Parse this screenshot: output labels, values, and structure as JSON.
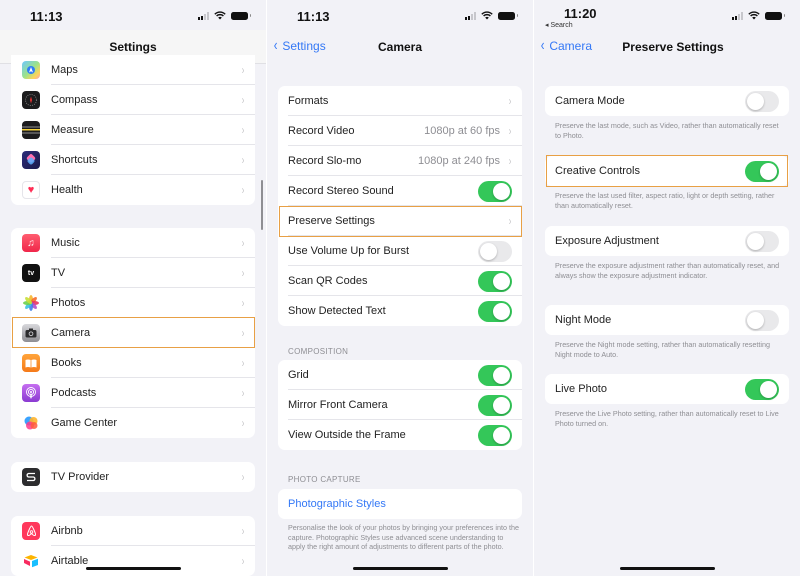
{
  "colors": {
    "accent": "#3478f6",
    "toggle_on": "#34c759",
    "highlight": "#e8a045",
    "background": "#f2f2f7"
  },
  "panel1": {
    "status": {
      "time": "11:13"
    },
    "title": "Settings",
    "groups": [
      {
        "items": [
          {
            "label": "Maps",
            "icon": "maps-icon"
          },
          {
            "label": "Compass",
            "icon": "compass-icon"
          },
          {
            "label": "Measure",
            "icon": "measure-icon"
          },
          {
            "label": "Shortcuts",
            "icon": "shortcuts-icon"
          },
          {
            "label": "Health",
            "icon": "health-icon"
          }
        ]
      },
      {
        "items": [
          {
            "label": "Music",
            "icon": "music-icon"
          },
          {
            "label": "TV",
            "icon": "tv-icon"
          },
          {
            "label": "Photos",
            "icon": "photos-icon"
          },
          {
            "label": "Camera",
            "icon": "camera-icon",
            "highlighted": true
          },
          {
            "label": "Books",
            "icon": "books-icon"
          },
          {
            "label": "Podcasts",
            "icon": "podcasts-icon"
          },
          {
            "label": "Game Center",
            "icon": "game-center-icon"
          }
        ]
      },
      {
        "items": [
          {
            "label": "TV Provider",
            "icon": "tv-provider-icon"
          }
        ]
      },
      {
        "items": [
          {
            "label": "Airbnb",
            "icon": "airbnb-icon"
          },
          {
            "label": "Airtable",
            "icon": "airtable-icon"
          }
        ]
      }
    ]
  },
  "panel2": {
    "status": {
      "time": "11:13"
    },
    "back_label": "Settings",
    "title": "Camera",
    "main_group": [
      {
        "label": "Formats",
        "type": "link"
      },
      {
        "label": "Record Video",
        "type": "link",
        "value": "1080p at 60 fps"
      },
      {
        "label": "Record Slo-mo",
        "type": "link",
        "value": "1080p at 240 fps"
      },
      {
        "label": "Record Stereo Sound",
        "type": "toggle",
        "on": true
      },
      {
        "label": "Preserve Settings",
        "type": "link",
        "highlighted": true
      },
      {
        "label": "Use Volume Up for Burst",
        "type": "toggle",
        "on": false
      },
      {
        "label": "Scan QR Codes",
        "type": "toggle",
        "on": true
      },
      {
        "label": "Show Detected Text",
        "type": "toggle",
        "on": true
      }
    ],
    "composition_header": "COMPOSITION",
    "composition_group": [
      {
        "label": "Grid",
        "type": "toggle",
        "on": true
      },
      {
        "label": "Mirror Front Camera",
        "type": "toggle",
        "on": true
      },
      {
        "label": "View Outside the Frame",
        "type": "toggle",
        "on": true
      }
    ],
    "photo_capture_header": "PHOTO CAPTURE",
    "photographic_styles_label": "Photographic Styles",
    "photographic_styles_footnote": "Personalise the look of your photos by bringing your preferences into the capture. Photographic Styles use advanced scene understanding to apply the right amount of adjustments to different parts of the photo."
  },
  "panel3": {
    "status": {
      "time": "11:20",
      "back_app": "◂ Search"
    },
    "back_label": "Camera",
    "title": "Preserve Settings",
    "items": [
      {
        "label": "Camera Mode",
        "on": false,
        "footnote": "Preserve the last mode, such as Video, rather than automatically reset to Photo."
      },
      {
        "label": "Creative Controls",
        "on": true,
        "highlighted": true,
        "footnote": "Preserve the last used filter, aspect ratio, light or depth setting, rather than automatically reset."
      },
      {
        "label": "Exposure Adjustment",
        "on": false,
        "footnote": "Preserve the exposure adjustment rather than automatically reset, and always show the exposure adjustment indicator."
      },
      {
        "label": "Night Mode",
        "on": false,
        "footnote": "Preserve the Night mode setting, rather than automatically resetting Night mode to Auto."
      },
      {
        "label": "Live Photo",
        "on": true,
        "footnote": "Preserve the Live Photo setting, rather than automatically reset to Live Photo turned on."
      }
    ]
  },
  "glyphs": {
    "chevron_right": "›",
    "chevron_left": "‹"
  }
}
